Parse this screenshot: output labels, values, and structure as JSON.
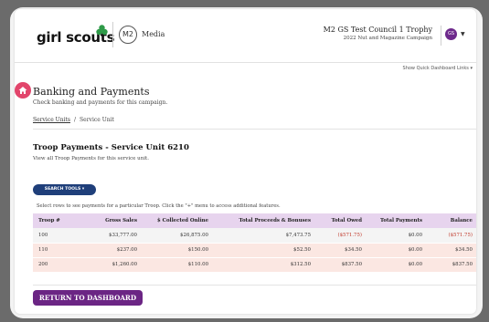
{
  "header": {
    "logo_text": "girl scouts",
    "m2_badge": "M2",
    "m2_label": "Media",
    "trophy_title": "M2 GS Test Council 1 Trophy",
    "trophy_subtitle": "2022 Nut and Magazine Campaign",
    "avatar_initials": "GS",
    "quick_links": "Show Quick Dashboard Links ▾"
  },
  "page": {
    "title": "Banking and Payments",
    "description": "Check banking and payments for this campaign.",
    "breadcrumb": {
      "link": "Service Units",
      "separator": "/",
      "current": "Service Unit"
    }
  },
  "section": {
    "title": "Troop Payments - Service Unit 6210",
    "description": "View all Troop Payments for this service unit.",
    "search_tools_label": "SEARCH TOOLS ▾",
    "instructions": "Select rows to see payments for a particular Troop. Click the \"+\" menu to access additional features."
  },
  "table": {
    "headers": [
      "Troop #",
      "Gross Sales",
      "$ Collected Online",
      "Total Proceeds & Bonuses",
      "Total Owed",
      "Total Payments",
      "Balance"
    ],
    "rows": [
      [
        "100",
        "$33,777.00",
        "$26,875.00",
        "$7,473.75",
        "($571.75)",
        "$0.00",
        "($571.75)"
      ],
      [
        "110",
        "$237.00",
        "$150.00",
        "$52.50",
        "$34.50",
        "$0.00",
        "$34.50"
      ],
      [
        "200",
        "$1,260.00",
        "$110.00",
        "$312.50",
        "$837.50",
        "$0.00",
        "$837.50"
      ]
    ]
  },
  "footer": {
    "return_label": "RETURN TO DASHBOARD"
  },
  "colors": {
    "brand_purple": "#6b2584",
    "search_blue": "#1f3f7a",
    "home_pink": "#e2456b",
    "header_row": "#e7d4ee",
    "negative": "#c0392b"
  },
  "icons": {
    "home": "home-icon",
    "trefoil": "trefoil-icon",
    "caret": "chevron-down-icon"
  }
}
